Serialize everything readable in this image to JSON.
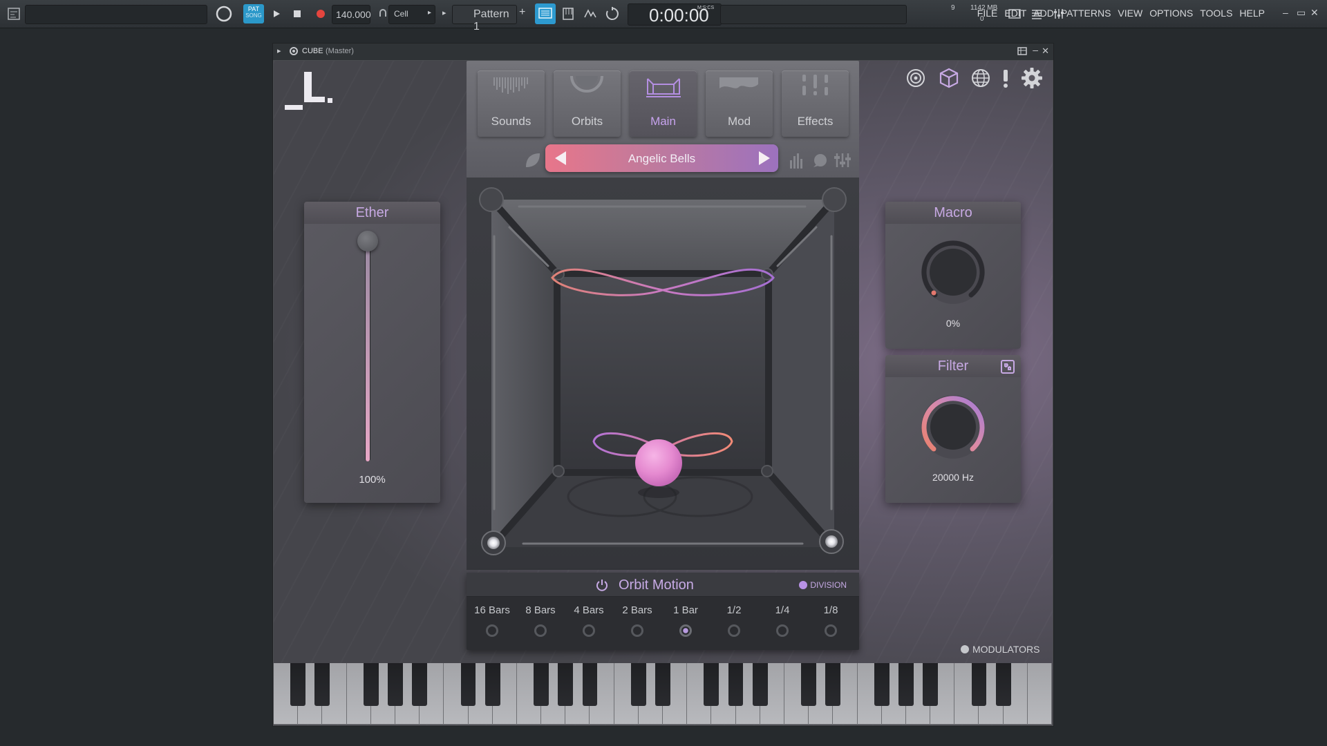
{
  "toolbar": {
    "pat_label": "PAT",
    "song_label": "SONG",
    "tempo": "140.000",
    "snap_label": "Cell",
    "pattern_label": "Pattern 1",
    "time": "0:00:00",
    "time_unit": "M:S:CS",
    "cpu_value": "9",
    "memory": "1142 MB",
    "voices": "0",
    "menu": [
      "FILE",
      "EDIT",
      "ADD",
      "PATTERNS",
      "VIEW",
      "OPTIONS",
      "TOOLS",
      "HELP"
    ]
  },
  "plugin": {
    "title": "CUBE",
    "title_suffix": "(Master)",
    "tabs": [
      {
        "label": "Sounds"
      },
      {
        "label": "Orbits"
      },
      {
        "label": "Main"
      },
      {
        "label": "Mod"
      },
      {
        "label": "Effects"
      }
    ],
    "active_tab": "Main",
    "preset_name": "Angelic Bells",
    "ether": {
      "title": "Ether",
      "value": "100%",
      "level": 1.0
    },
    "macro": {
      "title": "Macro",
      "value": "0%",
      "level": 0.0
    },
    "filter": {
      "title": "Filter",
      "value": "20000 Hz",
      "level": 1.0
    },
    "orbit_motion": {
      "title": "Orbit Motion",
      "division_label": "DIVISION",
      "options": [
        "16 Bars",
        "8 Bars",
        "4 Bars",
        "2 Bars",
        "1 Bar",
        "1/2",
        "1/4",
        "1/8"
      ],
      "selected": "1 Bar"
    },
    "modulators_label": "MODULATORS"
  },
  "colors": {
    "accent_purple": "#c7a9e3",
    "preset_gradient_start": "#e8768a",
    "preset_gradient_end": "#9c72be",
    "orb": "#e58ad0"
  }
}
